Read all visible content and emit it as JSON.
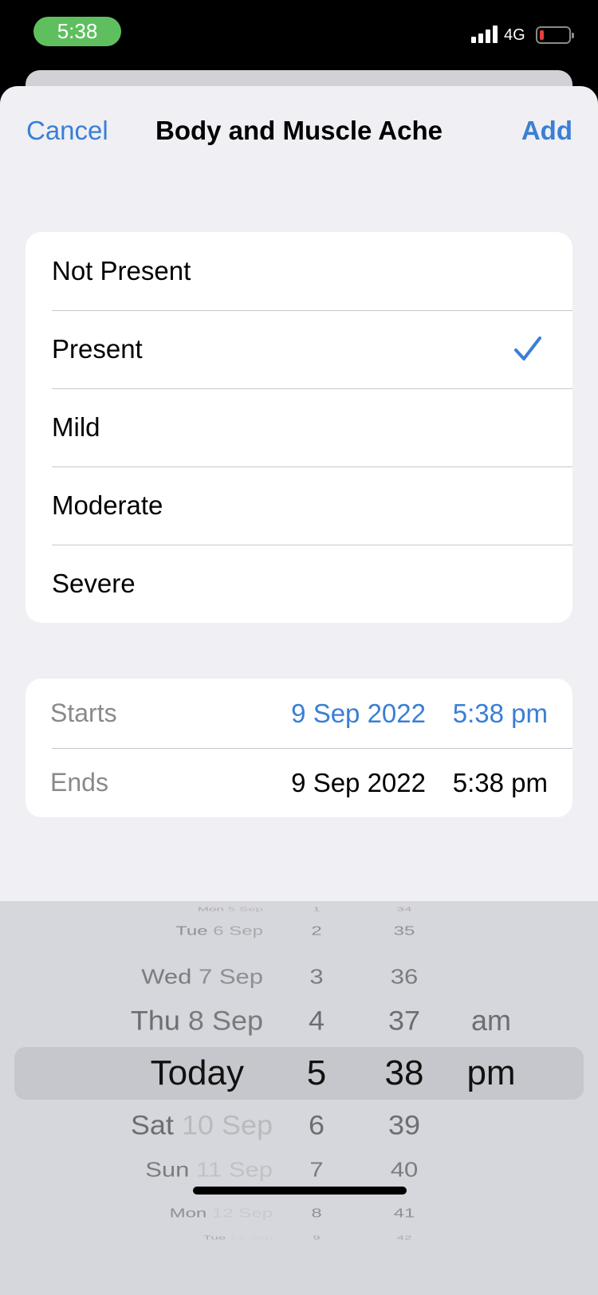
{
  "status_bar": {
    "time": "5:38",
    "network": "4G"
  },
  "nav": {
    "cancel": "Cancel",
    "title": "Body and Muscle Ache",
    "add": "Add"
  },
  "severity_options": [
    {
      "label": "Not Present",
      "selected": false
    },
    {
      "label": "Present",
      "selected": true
    },
    {
      "label": "Mild",
      "selected": false
    },
    {
      "label": "Moderate",
      "selected": false
    },
    {
      "label": "Severe",
      "selected": false
    }
  ],
  "times": {
    "starts": {
      "label": "Starts",
      "date": "9 Sep 2022",
      "time": "5:38 pm"
    },
    "ends": {
      "label": "Ends",
      "date": "9 Sep 2022",
      "time": "5:38 pm"
    }
  },
  "picker": {
    "days": [
      {
        "weekday": "Mon",
        "date": "5 Sep"
      },
      {
        "weekday": "Tue",
        "date": "6 Sep"
      },
      {
        "weekday": "Wed",
        "date": "7 Sep"
      },
      {
        "weekday": "Thu",
        "date": "8 Sep"
      },
      {
        "weekday": "Today",
        "date": ""
      },
      {
        "weekday": "Sat",
        "date": "10 Sep"
      },
      {
        "weekday": "Sun",
        "date": "11 Sep"
      },
      {
        "weekday": "Mon",
        "date": "12 Sep"
      },
      {
        "weekday": "Tue",
        "date": "13 Sep"
      }
    ],
    "hours": [
      "1",
      "2",
      "3",
      "4",
      "5",
      "6",
      "7",
      "8",
      "9"
    ],
    "minutes": [
      "34",
      "35",
      "36",
      "37",
      "38",
      "39",
      "40",
      "41",
      "42"
    ],
    "periods": [
      "am",
      "pm"
    ],
    "selected": {
      "day": "Today",
      "hour": "5",
      "minute": "38",
      "period": "pm"
    }
  },
  "colors": {
    "accent": "#3a7fd5",
    "time_pill": "#5fbf5f",
    "battery_low": "#e5413a"
  }
}
